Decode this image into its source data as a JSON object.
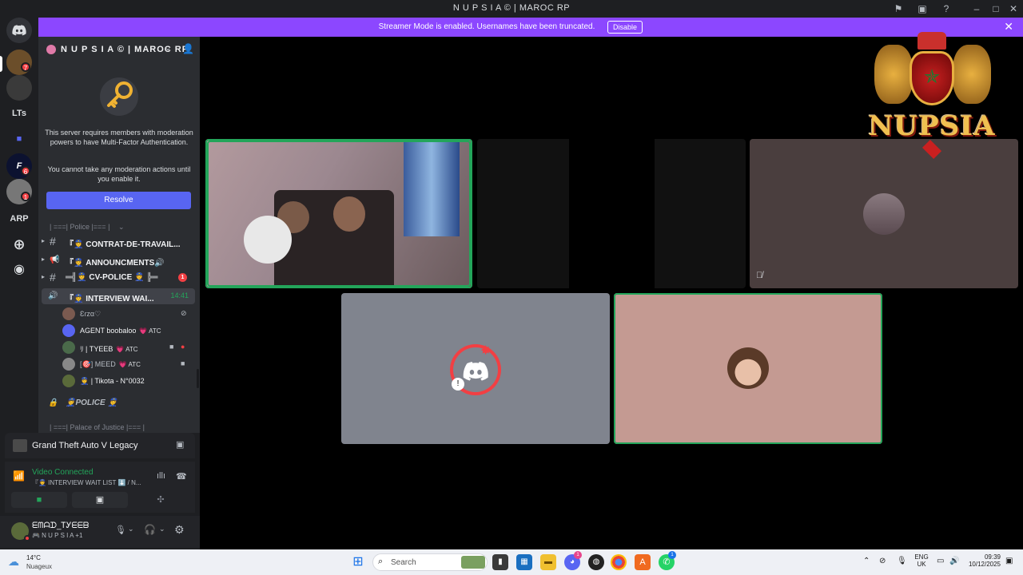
{
  "window": {
    "title": "N U P S I A ©  | MAROC RP"
  },
  "banner": {
    "text": "Streamer Mode is enabled. Usernames have been truncated.",
    "button": "Disable"
  },
  "rail": {
    "items": [
      {
        "label": "LTs"
      },
      {
        "label": "ARP"
      }
    ],
    "badges": [
      "7",
      "6",
      "1"
    ]
  },
  "server": {
    "name": "N U P S I A ©  | MAROC RP",
    "mfa_line1": "This server requires members with moderation powers to have Multi-Factor Authentication.",
    "mfa_line2": "You cannot take any moderation actions until you enable it.",
    "resolve": "Resolve"
  },
  "channels": {
    "category_police": "| ===| Police |=== |",
    "items": [
      {
        "icon": "#",
        "name": "『👮 CONTRAT-DE-TRAVAIL..."
      },
      {
        "icon": "📢",
        "name": "『👮 ANNOUNCMENTS🔊"
      },
      {
        "icon": "#",
        "name": "═╣👮 CV-POLICE 👮 ╠═",
        "badge": "1"
      },
      {
        "icon": "🔊",
        "name": "『👮 INTERVIEW WAI...",
        "timer": "14:41"
      }
    ],
    "voice_users": [
      {
        "name": "Ɛɾzα♡",
        "atc": ""
      },
      {
        "name": "AGENT boobaloo",
        "atc": "💗 ATC"
      },
      {
        "name": "ﾘ | TYEEB",
        "atc": "💗 ATC"
      },
      {
        "name": "[🎯] MEED",
        "atc": "💗 ATC"
      },
      {
        "name": "👮 | Tikota - N°0032",
        "atc": ""
      }
    ],
    "locked_channel": "👮POLICE 👮",
    "category_justice": "| ===| Palace of Justice |=== |"
  },
  "activity": {
    "game": "Grand Theft Auto V Legacy"
  },
  "voice": {
    "status": "Video Connected",
    "channel": "『👮 INTERVIEW WAIT LIST ⬇️ / N..."
  },
  "user": {
    "name": "ᗴᗰᗩᗪ_ᎢᎩᗴᗴᗷ",
    "sub": "🎮 N U P S I A +1"
  },
  "overlay_logo": {
    "text": "NUPSIA"
  },
  "taskbar": {
    "weather_temp": "14°C",
    "weather_desc": "Nuageux",
    "search": "Search",
    "lang1": "ENG",
    "lang2": "UK",
    "time": "09:39",
    "date": "10/12/2025",
    "discord_badge": "1",
    "whatsapp_badge": "1"
  }
}
